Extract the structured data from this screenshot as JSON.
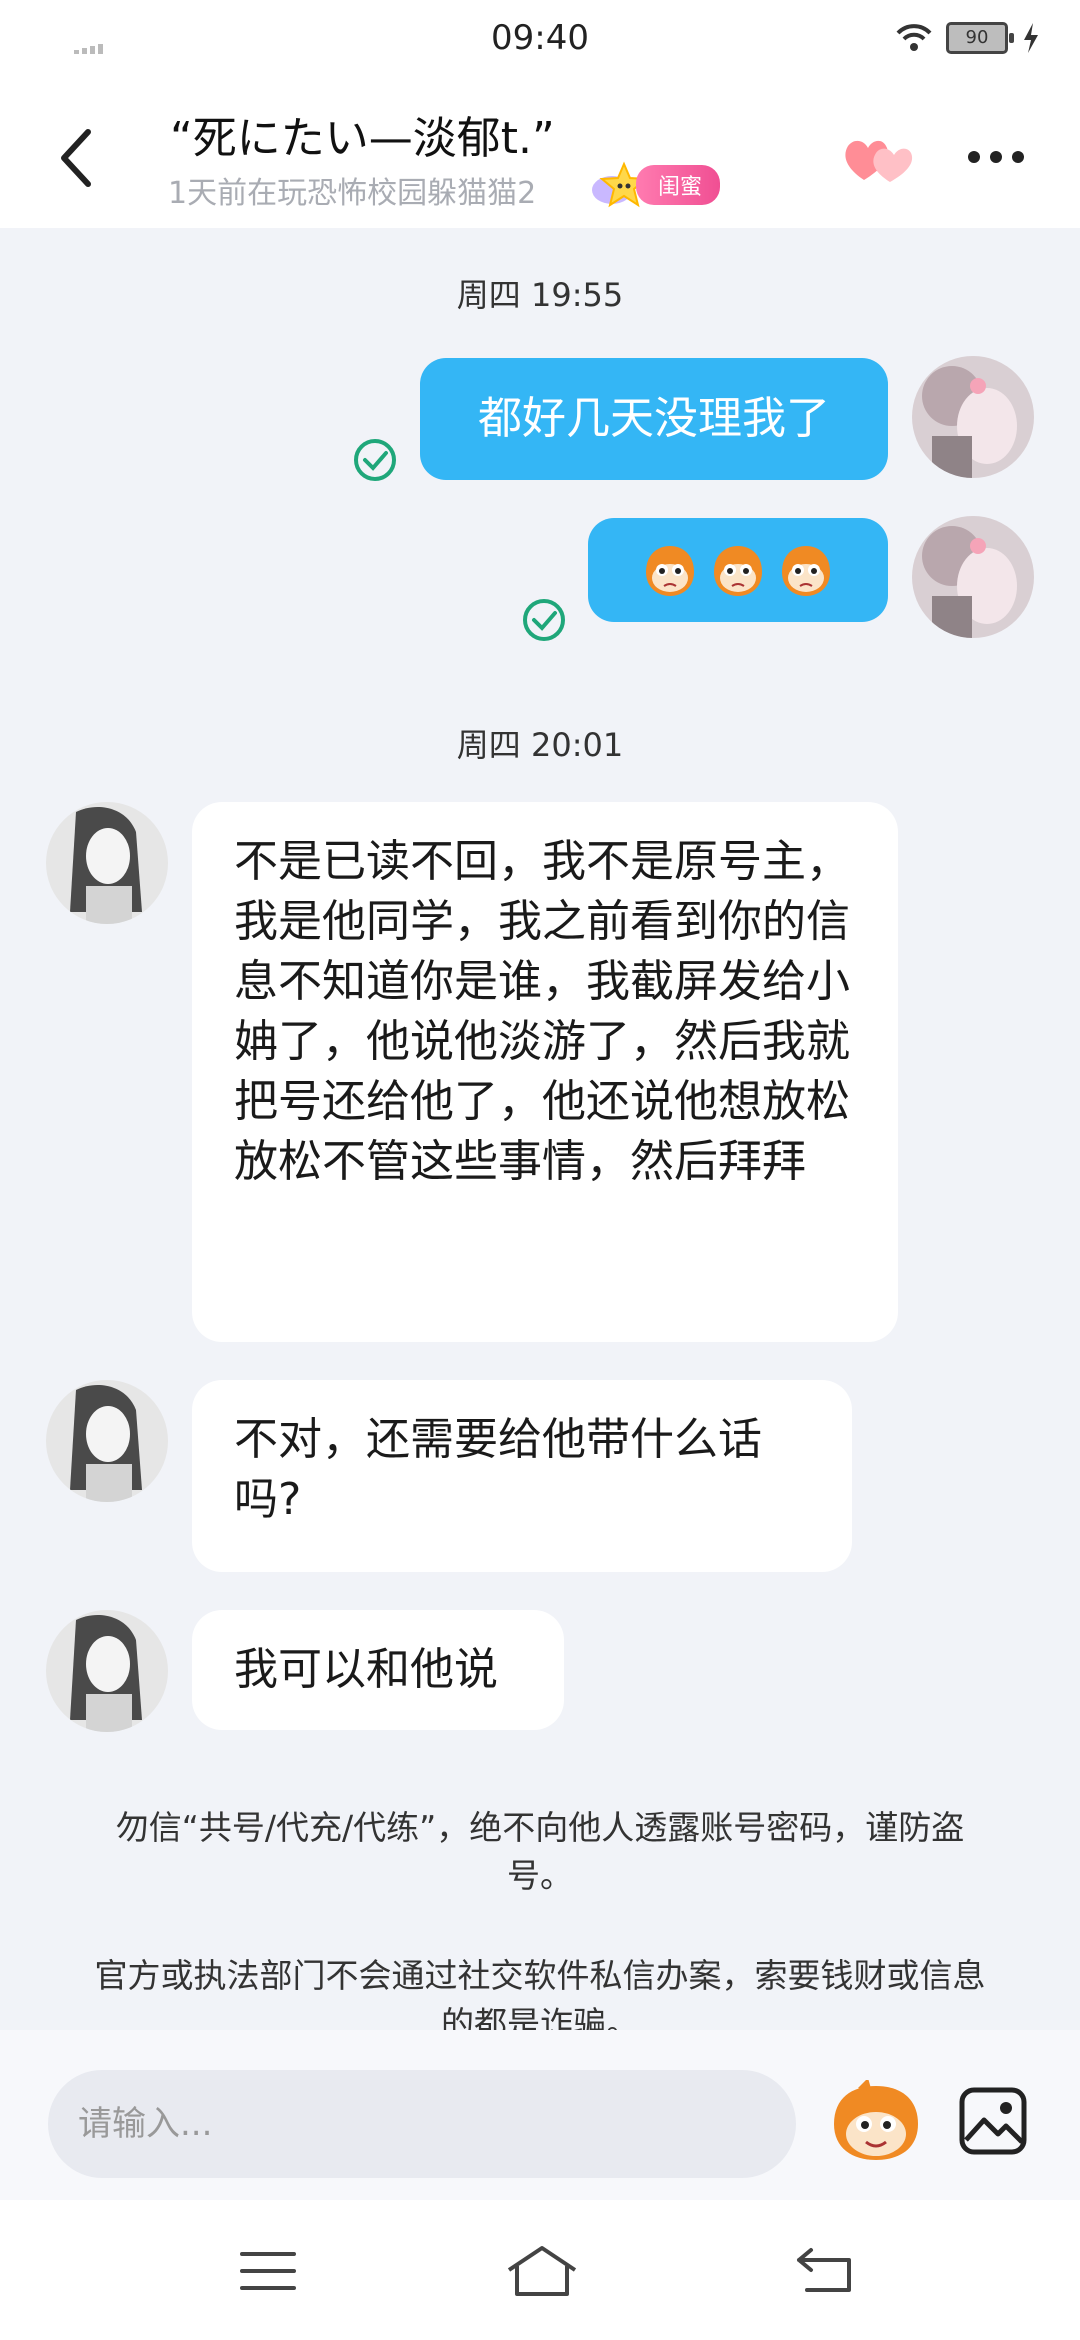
{
  "status_bar": {
    "time": "09:40",
    "battery": "90"
  },
  "header": {
    "title": "“死にたい—淡郁t.”",
    "subtitle": "1天前在玩恐怖校园躲猫猫2",
    "badge": "闺蜜"
  },
  "messages": {
    "ts1": "周四 19:55",
    "out1": "都好几天没理我了",
    "ts2": "周四 20:01",
    "in1": "不是已读不回，我不是原号主，我是他同学，我之前看到你的信息不知道你是谁，我截屏发给小姌了，他说他淡游了，然后我就把号还给他了，他还说他想放松放松不管这些事情，然后拜拜",
    "in2": "不对，还需要给他带什么话吗?",
    "in3": "我可以和他说"
  },
  "notice": {
    "line1": "勿信“共号/代充/代练”，绝不向他人透露账号密码，谨防盗号。",
    "line2": "官方或执法部门不会通过社交软件私信办案，索要钱财或信息的都是诈骗。"
  },
  "input": {
    "placeholder": "请输入..."
  },
  "colors": {
    "bubble_out": "#34b6f5",
    "check": "#1fa77a",
    "badge": "#f04f93",
    "background": "#f1f3f8"
  }
}
